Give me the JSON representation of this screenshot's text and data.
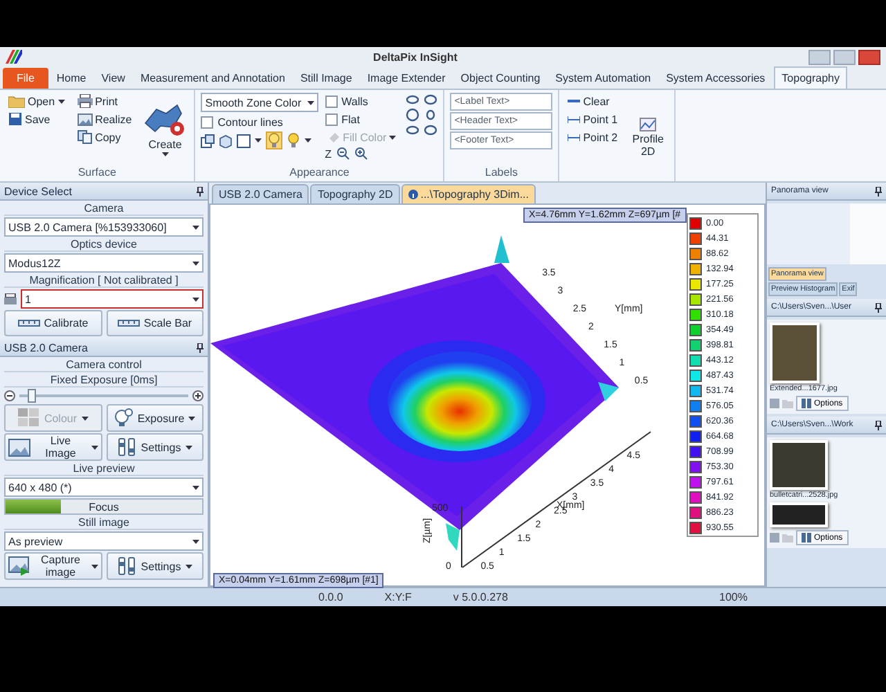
{
  "window": {
    "title": "DeltaPix InSight"
  },
  "ribbon": {
    "file_tab": "File",
    "tabs": [
      {
        "label": "Home",
        "selected": false
      },
      {
        "label": "View",
        "selected": false
      },
      {
        "label": "Measurement and Annotation",
        "selected": false
      },
      {
        "label": "Still Image",
        "selected": false
      },
      {
        "label": "Image Extender",
        "selected": false
      },
      {
        "label": "Object Counting",
        "selected": false
      },
      {
        "label": "System Automation",
        "selected": false
      },
      {
        "label": "System Accessories",
        "selected": false
      },
      {
        "label": "Topography",
        "selected": true
      }
    ],
    "surface": {
      "label": "Surface",
      "open": "Open",
      "save": "Save",
      "print": "Print",
      "realize": "Realize",
      "copy": "Copy",
      "create": "Create"
    },
    "appearance": {
      "label": "Appearance",
      "color_mode": "Smooth Zone Color",
      "options": [
        {
          "label": "Contour lines",
          "checked": false
        },
        {
          "label": "Walls",
          "checked": false
        },
        {
          "label": "Flat",
          "checked": false
        }
      ],
      "fill_color": {
        "label": "Fill Color",
        "disabled": true
      },
      "zoom_mark": "Z"
    },
    "labels": {
      "label": "Labels",
      "fields": [
        {
          "placeholder": "<Label Text>"
        },
        {
          "placeholder": "<Header Text>"
        },
        {
          "placeholder": "<Footer Text>"
        }
      ]
    },
    "profile": {
      "clear": "Clear",
      "points": [
        "Point 1",
        "Point 2"
      ],
      "profile": "Profile 2D"
    }
  },
  "device_select": {
    "title": "Device Select",
    "camera_label": "Camera",
    "camera": "USB 2.0 Camera  [%153933060]",
    "optics_label": "Optics device",
    "optics": "Modus12Z",
    "magnification_label": "Magnification [ Not calibrated ]",
    "magnification": "1",
    "buttons": [
      "Calibrate",
      "Scale Bar"
    ]
  },
  "camera_panel": {
    "title": "USB 2.0 Camera",
    "control_label": "Camera control",
    "exposure_label": "Fixed Exposure [0ms]",
    "exposure": {
      "level": 0.05
    },
    "buttons": [
      {
        "kind": "colour",
        "label": "Colour",
        "disabled": true
      },
      {
        "kind": "exposure",
        "label": "Exposure",
        "disabled": false
      },
      {
        "kind": "live",
        "label": "Live Image",
        "disabled": false
      },
      {
        "kind": "settings",
        "label": "Settings",
        "disabled": false
      }
    ],
    "live_preview_label": "Live preview",
    "resolution": "640 x 480 (*)",
    "focus": {
      "label": "Focus",
      "level": 0.28
    },
    "still_label": "Still image",
    "still_mode": "As preview",
    "still_buttons": [
      {
        "kind": "capture",
        "label": "Capture image",
        "disabled": false
      },
      {
        "kind": "settings",
        "label": "Settings",
        "disabled": false
      }
    ]
  },
  "document_tabs": [
    {
      "label": "USB 2.0 Camera",
      "selected": false
    },
    {
      "label": "Topography 2D",
      "selected": false
    },
    {
      "label": "...\\Topography 3Dim...",
      "selected": true
    }
  ],
  "view": {
    "x_label": "X[mm]",
    "x_ticks": [
      "0.5",
      "1",
      "1.5",
      "2",
      "2.5",
      "3",
      "3.5",
      "4",
      "4.5"
    ],
    "y_label": "Y[mm]",
    "y_ticks": [
      "3.5",
      "3",
      "2.5",
      "2",
      "1.5",
      "1",
      "0.5"
    ],
    "z_label": "Z[µm]",
    "z_ticks": [
      "500",
      "0"
    ],
    "tooltips": [
      "X=0.04mm Y=1.61mm Z=698µm [#1]",
      "X=4.76mm Y=1.62mm Z=697µm [#"
    ],
    "legend": [
      {
        "value": "0.00",
        "color": "#e00000"
      },
      {
        "value": "44.31",
        "color": "#f04000"
      },
      {
        "value": "88.62",
        "color": "#f08000"
      },
      {
        "value": "132.94",
        "color": "#f0b000"
      },
      {
        "value": "177.25",
        "color": "#e8e800"
      },
      {
        "value": "221.56",
        "color": "#a8e800"
      },
      {
        "value": "310.18",
        "color": "#30e000"
      },
      {
        "value": "354.49",
        "color": "#10d030"
      },
      {
        "value": "398.81",
        "color": "#10d070"
      },
      {
        "value": "443.12",
        "color": "#10e0b0"
      },
      {
        "value": "487.43",
        "color": "#10e8e8"
      },
      {
        "value": "531.74",
        "color": "#10b8f0"
      },
      {
        "value": "576.05",
        "color": "#1080f0"
      },
      {
        "value": "620.36",
        "color": "#1050f0"
      },
      {
        "value": "664.68",
        "color": "#1020f0"
      },
      {
        "value": "708.99",
        "color": "#4010f0"
      },
      {
        "value": "753.30",
        "color": "#8010f0"
      },
      {
        "value": "797.61",
        "color": "#c010f0"
      },
      {
        "value": "841.92",
        "color": "#e010c0"
      },
      {
        "value": "886.23",
        "color": "#e01080"
      },
      {
        "value": "930.55",
        "color": "#e01040"
      }
    ],
    "zoom": "100%"
  },
  "right_panel": {
    "panorama_title": "Panorama view",
    "tabs": [
      {
        "label": "Panorama view",
        "selected": true
      },
      {
        "label": "Preview Histogram",
        "selected": false
      },
      {
        "label": "Exif",
        "selected": false
      }
    ],
    "folders": [
      {
        "title": "C:\\Users\\Sven...\\User",
        "images": [
          {
            "caption": "Extended...1677.jpg",
            "partial": false
          }
        ],
        "options": "Options"
      },
      {
        "title": "C:\\Users\\Sven...\\Work",
        "images": [
          {
            "caption": "bulletcatri...2528.jpg",
            "partial": false
          },
          {
            "partial": true
          }
        ],
        "options": "Options"
      }
    ]
  },
  "status_bar": [
    "0.0.0",
    "X:Y:F",
    "v 5.0.0.278"
  ]
}
